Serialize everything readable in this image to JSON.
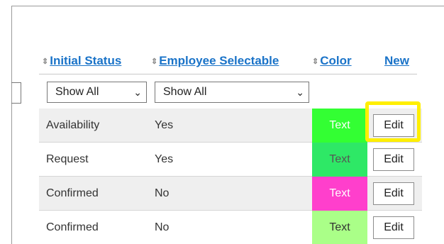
{
  "columns": {
    "initial_status": "Initial Status",
    "employee_selectable": "Employee Selectable",
    "color": "Color",
    "new_link": "New"
  },
  "sort_icon": "sort-updown-icon",
  "filters": {
    "initial_status_value": "Show All",
    "employee_selectable_value": "Show All"
  },
  "rows": [
    {
      "initial_status": "Availability",
      "employee_selectable": "Yes",
      "color_label": "Text",
      "color_bg": "#33ff33",
      "color_fg": "#ffffff",
      "edit_label": "Edit"
    },
    {
      "initial_status": "Request",
      "employee_selectable": "Yes",
      "color_label": "Text",
      "color_bg": "#2ee866",
      "color_fg": "#555555",
      "edit_label": "Edit"
    },
    {
      "initial_status": "Confirmed",
      "employee_selectable": "No",
      "color_label": "Text",
      "color_bg": "#ff3fcc",
      "color_fg": "#ffffff",
      "edit_label": "Edit"
    },
    {
      "initial_status": "Confirmed",
      "employee_selectable": "No",
      "color_label": "Text",
      "color_bg": "#aaff88",
      "color_fg": "#333333",
      "edit_label": "Edit"
    }
  ],
  "highlight_color": "#ffef00",
  "link_color": "#1a73c8"
}
